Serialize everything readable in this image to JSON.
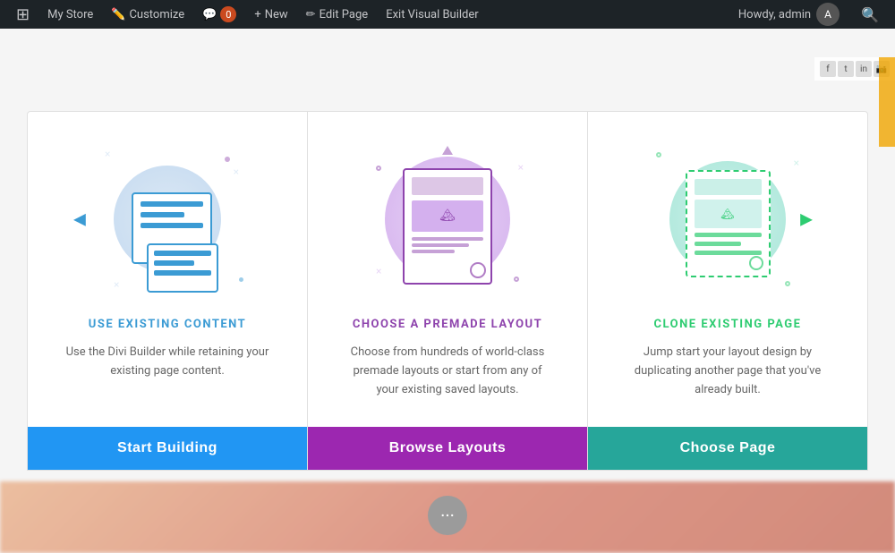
{
  "adminBar": {
    "wpIcon": "⊞",
    "myStore": "My Store",
    "customize": "Customize",
    "comments": "0",
    "new": "New",
    "editPage": "Edit Page",
    "exitVisualBuilder": "Exit Visual Builder",
    "howdy": "Howdy, admin",
    "searchIcon": "🔍"
  },
  "cards": [
    {
      "id": "use-existing",
      "title": "USE EXISTING CONTENT",
      "titleColor": "#3b9bd4",
      "description": "Use the Divi Builder while retaining your existing page content.",
      "buttonLabel": "Start Building",
      "buttonColor": "#2196F3"
    },
    {
      "id": "choose-premade",
      "title": "CHOOSE A PREMADE LAYOUT",
      "titleColor": "#8e44ad",
      "description": "Choose from hundreds of world-class premade layouts or start from any of your existing saved layouts.",
      "buttonLabel": "Browse Layouts",
      "buttonColor": "#9c27b0"
    },
    {
      "id": "clone-page",
      "title": "CLONE EXISTING PAGE",
      "titleColor": "#2ecc71",
      "description": "Jump start your layout design by duplicating another page that you've already built.",
      "buttonLabel": "Choose Page",
      "buttonColor": "#26a69a"
    }
  ],
  "floatBtn": "...",
  "social": [
    "f",
    "t",
    "in",
    "📷"
  ]
}
